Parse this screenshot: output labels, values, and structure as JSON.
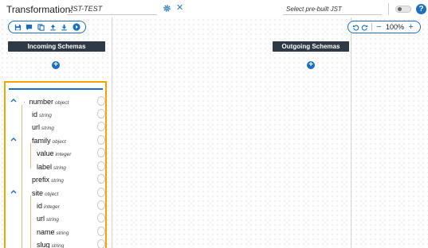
{
  "header": {
    "title_label": "Transformation:",
    "name_value": "JST-TEST",
    "prebuilt_placeholder": "Select pre-built JST"
  },
  "zoom": {
    "level": "100%"
  },
  "columns": {
    "incoming": "Incoming Schemas",
    "outgoing": "Outgoing Schemas"
  },
  "schema": {
    "nodes": [
      {
        "name": "number",
        "type": "object"
      },
      {
        "name": "id",
        "type": "string"
      },
      {
        "name": "url",
        "type": "string"
      },
      {
        "name": "family",
        "type": "object"
      },
      {
        "name": "value",
        "type": "integer"
      },
      {
        "name": "label",
        "type": "string"
      },
      {
        "name": "prefix",
        "type": "string"
      },
      {
        "name": "site",
        "type": "object"
      },
      {
        "name": "id",
        "type": "integer"
      },
      {
        "name": "url",
        "type": "string"
      },
      {
        "name": "name",
        "type": "string"
      },
      {
        "name": "slug",
        "type": "string"
      }
    ]
  },
  "colors": {
    "accent": "#1a6fbe",
    "header_bg": "#2f3a46",
    "highlight": "#f5a300"
  }
}
